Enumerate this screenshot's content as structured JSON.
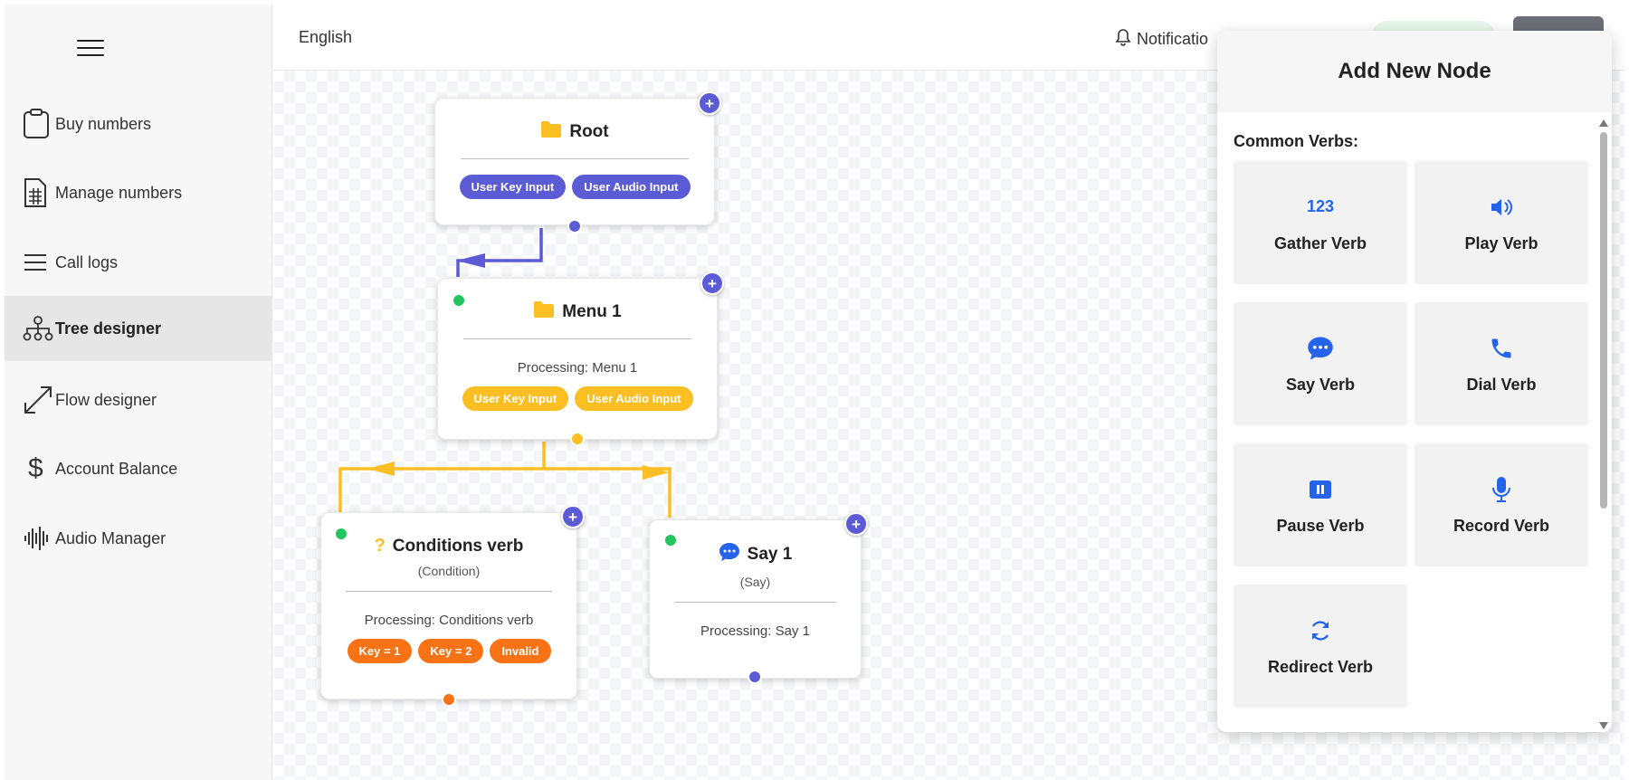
{
  "sidebar": {
    "items": [
      {
        "label": "Buy numbers",
        "icon": "clipboard-icon"
      },
      {
        "label": "Manage numbers",
        "icon": "spreadsheet-icon"
      },
      {
        "label": "Call logs",
        "icon": "list-icon"
      },
      {
        "label": "Tree designer",
        "icon": "org-tree-icon",
        "active": true
      },
      {
        "label": "Flow designer",
        "icon": "expand-arrows-icon"
      },
      {
        "label": "Account Balance",
        "icon": "dollar-icon"
      },
      {
        "label": "Audio Manager",
        "icon": "waveform-icon"
      }
    ]
  },
  "topbar": {
    "language": "English",
    "notifications": "Notificatio"
  },
  "nodes": {
    "root": {
      "title": "Root",
      "chips": [
        "User Key Input",
        "User Audio Input"
      ]
    },
    "menu1": {
      "title": "Menu 1",
      "processing": "Processing: Menu 1",
      "chips": [
        "User Key Input",
        "User Audio Input"
      ]
    },
    "conditions": {
      "title": "Conditions verb",
      "subtitle": "(Condition)",
      "processing": "Processing: Conditions verb",
      "chips": [
        "Key = 1",
        "Key = 2",
        "Invalid"
      ]
    },
    "say1": {
      "title": "Say 1",
      "subtitle": "(Say)",
      "processing": "Processing: Say 1"
    },
    "add_symbol": "+"
  },
  "panel": {
    "title": "Add New Node",
    "section": "Common Verbs:",
    "verbs": [
      {
        "label": "Gather Verb",
        "icon": "123"
      },
      {
        "label": "Play Verb",
        "icon": "speaker-icon"
      },
      {
        "label": "Say Verb",
        "icon": "chat-bubble-icon"
      },
      {
        "label": "Dial Verb",
        "icon": "phone-icon"
      },
      {
        "label": "Pause Verb",
        "icon": "pause-icon"
      },
      {
        "label": "Record Verb",
        "icon": "microphone-icon"
      },
      {
        "label": "Redirect Verb",
        "icon": "redirect-icon"
      }
    ]
  },
  "colors": {
    "purple": "#5b5bd6",
    "yellow": "#fbbf24",
    "orange": "#f97316",
    "green": "#22c55e",
    "icon_blue": "#2563eb"
  }
}
